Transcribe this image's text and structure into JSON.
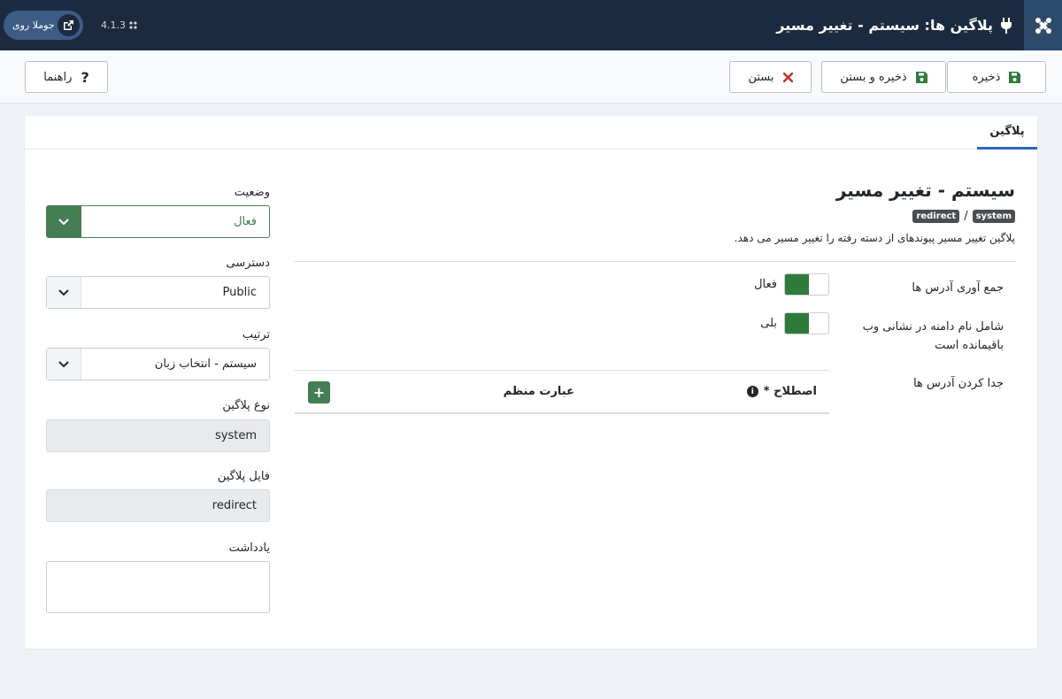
{
  "header": {
    "title": "پلاگین ها: سیستم - تغییر مسیر",
    "site_label": "جوملا روی",
    "version": "4.1.3"
  },
  "toolbar": {
    "save_label": "ذخیره",
    "save_close_label": "ذخیره و بستن",
    "close_label": "بستن",
    "help_label": "راهنما"
  },
  "tabs": [
    {
      "label": "پلاگین"
    }
  ],
  "main": {
    "title": "سیستم - تغییر مسیر",
    "badges": [
      "system",
      "redirect"
    ],
    "separator": "/",
    "description": "پلاگین تغییر مسیر پیوندهای از دسته رفته را تغییر مسیر می دهد.",
    "collect_urls": {
      "label": "جمع آوری آدرس ها",
      "value": "فعال"
    },
    "include_domain": {
      "label": "شامل نام دامنه در نشانی وب باقیمانده است",
      "value": "بلی"
    },
    "exclude_urls": {
      "label": "جدا کردن آدرس ها"
    },
    "table": {
      "term_header": "اصطلاح *",
      "regex_header": "عبارت منظم",
      "add_symbol": "+"
    }
  },
  "sidebar": {
    "status": {
      "label": "وضعیت",
      "value": "فعال"
    },
    "access": {
      "label": "دسترسی",
      "value": "Public"
    },
    "ordering": {
      "label": "ترتیب",
      "value": "سیستم - انتخاب زبان"
    },
    "plugin_type": {
      "label": "نوع پلاگین",
      "value": "system"
    },
    "plugin_file": {
      "label": "فایل پلاگین",
      "value": "redirect"
    },
    "note": {
      "label": "یادداشت",
      "value": ""
    }
  },
  "colors": {
    "header_bg": "#1c2a3f",
    "accent_green": "#457d54",
    "tab_underline": "#2a69b8"
  }
}
